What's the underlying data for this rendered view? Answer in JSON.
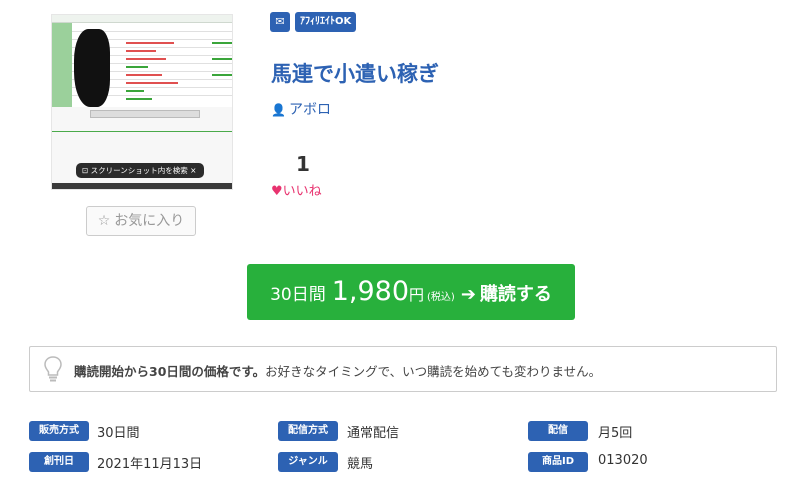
{
  "product": {
    "tags": {
      "mail_icon": "envelope-icon",
      "affiliate": "ｱﾌｨﾘｴｲﾄOK"
    },
    "title": "馬連で小遣い稼ぎ",
    "author": "アボロ",
    "likes": {
      "count": "1",
      "label": "いいね"
    },
    "favorite_label": "お気に入り",
    "thumbnail": {
      "popup_text": "スクリーンショット内を検索"
    }
  },
  "purchase": {
    "period": "30日間",
    "price": "1,980",
    "yen": "円",
    "tax": "(税込)",
    "action": "購読する"
  },
  "notice": {
    "bold": "購読開始から30日間の価格です。",
    "text": "お好きなタイミングで、いつ購読を始めても変わりません。"
  },
  "info": {
    "sale_type": {
      "label": "販売方式",
      "value": "30日間"
    },
    "delivery_type": {
      "label": "配信方式",
      "value": "通常配信"
    },
    "delivery": {
      "label": "配信",
      "value": "月5回"
    },
    "created": {
      "label": "創刊日",
      "value": "2021年11月13日"
    },
    "genre": {
      "label": "ジャンル",
      "value": "競馬"
    },
    "product_id": {
      "label": "商品ID",
      "value": "013020"
    }
  },
  "colors": {
    "accent": "#2d62b3",
    "buy_green": "#28b03c",
    "like_pink": "#e8336f"
  }
}
